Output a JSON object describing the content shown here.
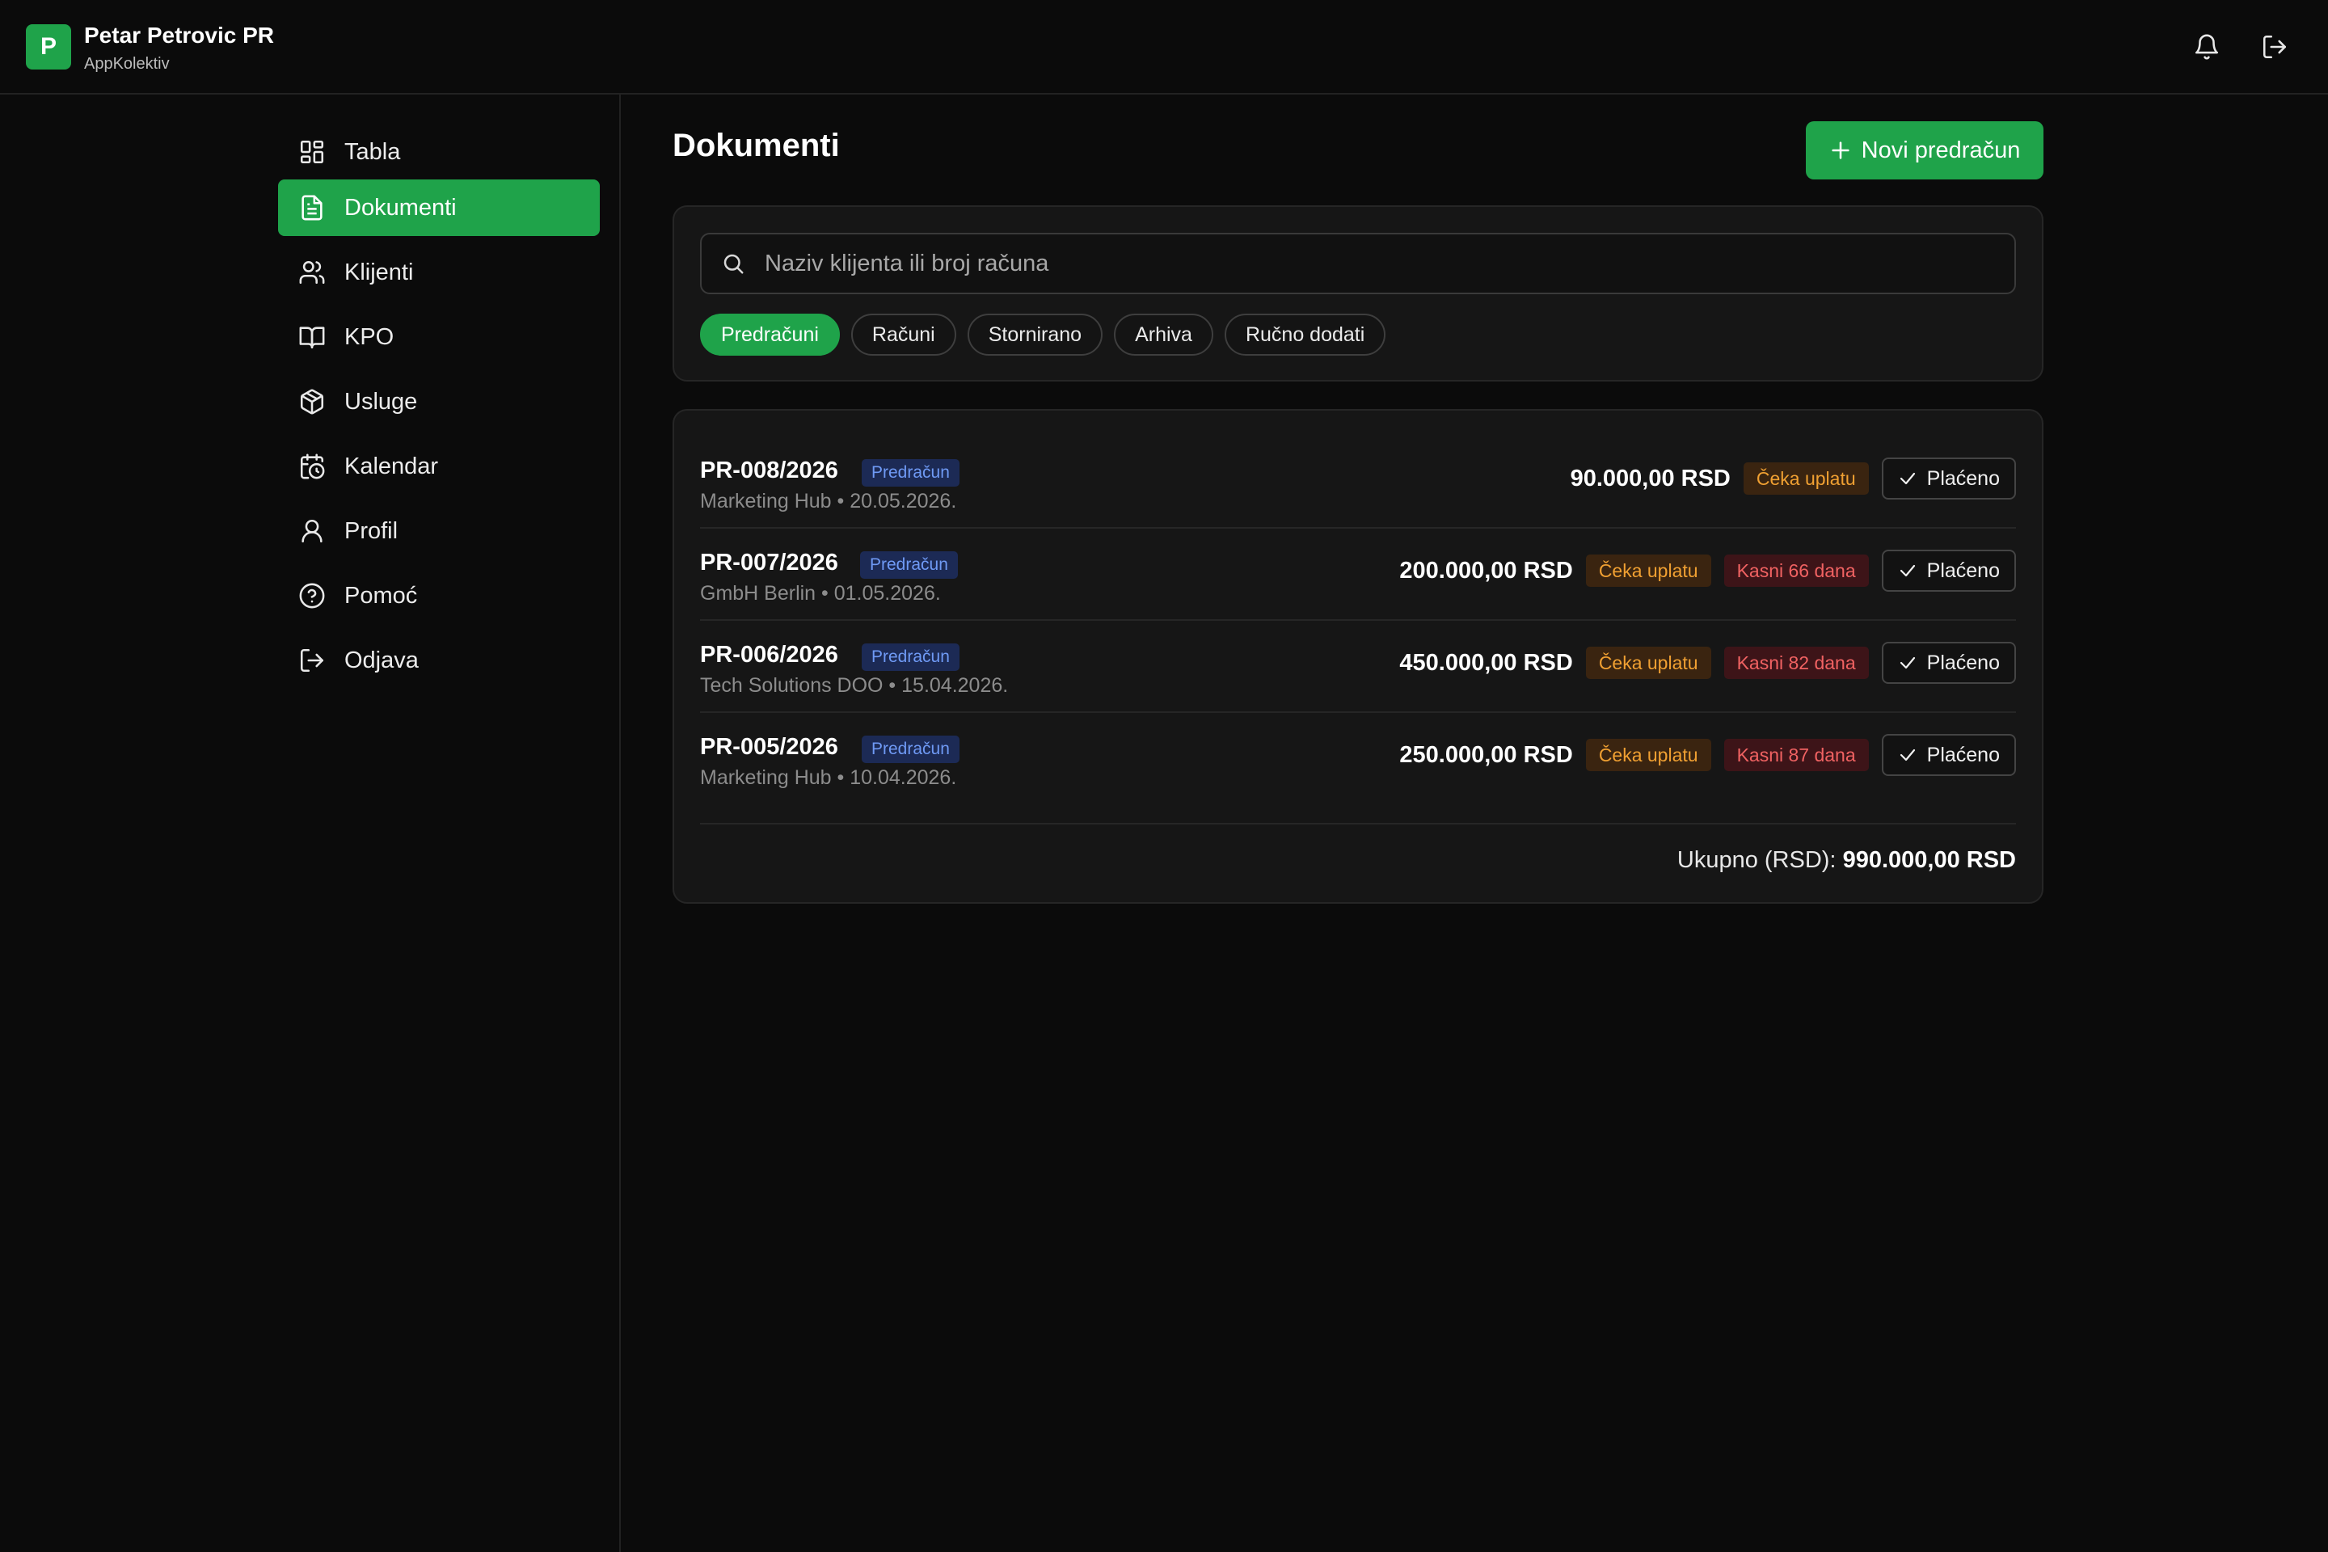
{
  "org": {
    "initial": "P",
    "name": "Petar Petrovic PR",
    "app": "AppKolektiv"
  },
  "header": {
    "bell_icon": "bell-icon",
    "logout_icon": "logout-icon"
  },
  "sidebar": {
    "items": [
      {
        "label": "Tabla",
        "icon": "dashboard-icon"
      },
      {
        "label": "Dokumenti",
        "icon": "document-icon",
        "active": true
      },
      {
        "label": "Klijenti",
        "icon": "users-icon"
      },
      {
        "label": "KPO",
        "icon": "book-icon"
      },
      {
        "label": "Usluge",
        "icon": "package-icon"
      },
      {
        "label": "Kalendar",
        "icon": "calendar-clock-icon"
      },
      {
        "label": "Profil",
        "icon": "user-icon"
      },
      {
        "label": "Pomoć",
        "icon": "help-circle-icon"
      },
      {
        "label": "Odjava",
        "icon": "logout-icon"
      }
    ]
  },
  "main": {
    "title": "Dokumenti",
    "new_button": "Novi predračun",
    "search": {
      "placeholder": "Naziv klijenta ili broj računa",
      "value": ""
    },
    "filters": [
      {
        "label": "Predračuni",
        "active": true
      },
      {
        "label": "Računi"
      },
      {
        "label": "Stornirano"
      },
      {
        "label": "Arhiva"
      },
      {
        "label": "Ručno dodati"
      }
    ],
    "documents": [
      {
        "number": "PR-008/2026",
        "type": "Predračun",
        "client": "Marketing Hub",
        "date": "20.05.2026.",
        "meta": "Marketing Hub • 20.05.2026.",
        "amount": "90.000,00 RSD",
        "status": "Čeka uplatu",
        "late": "",
        "action": "Plaćeno"
      },
      {
        "number": "PR-007/2026",
        "type": "Predračun",
        "client": "GmbH Berlin",
        "date": "01.05.2026.",
        "meta": "GmbH Berlin • 01.05.2026.",
        "amount": "200.000,00 RSD",
        "status": "Čeka uplatu",
        "late": "Kasni 66 dana",
        "action": "Plaćeno"
      },
      {
        "number": "PR-006/2026",
        "type": "Predračun",
        "client": "Tech Solutions DOO",
        "date": "15.04.2026.",
        "meta": "Tech Solutions DOO • 15.04.2026.",
        "amount": "450.000,00 RSD",
        "status": "Čeka uplatu",
        "late": "Kasni 82 dana",
        "action": "Plaćeno"
      },
      {
        "number": "PR-005/2026",
        "type": "Predračun",
        "client": "Marketing Hub",
        "date": "10.04.2026.",
        "meta": "Marketing Hub • 10.04.2026.",
        "amount": "250.000,00 RSD",
        "status": "Čeka uplatu",
        "late": "Kasni 87 dana",
        "action": "Plaćeno"
      }
    ],
    "total_label": "Ukupno (RSD):",
    "total_value": "990.000,00 RSD"
  },
  "colors": {
    "accent": "#1fa34a",
    "background": "#0b0b0b",
    "panel": "#161616",
    "warning": "#f0a032",
    "danger": "#f06262",
    "info": "#6f9af5"
  }
}
